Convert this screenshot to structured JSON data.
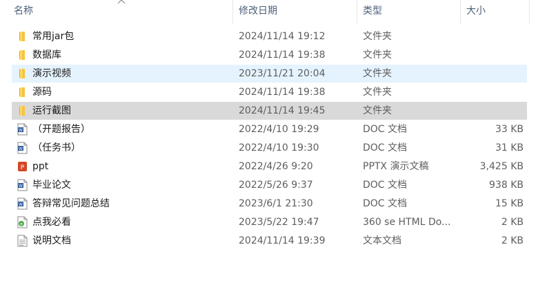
{
  "columns": {
    "name": "名称",
    "date": "修改日期",
    "type": "类型",
    "size": "大小"
  },
  "rows": [
    {
      "name": "常用jar包",
      "date": "2024/11/14 19:12",
      "type": "文件夹",
      "size": "",
      "icon": "folder-icon",
      "state": "normal"
    },
    {
      "name": "数据库",
      "date": "2024/11/14 19:38",
      "type": "文件夹",
      "size": "",
      "icon": "folder-icon",
      "state": "normal"
    },
    {
      "name": "演示视频",
      "date": "2023/11/21 20:04",
      "type": "文件夹",
      "size": "",
      "icon": "folder-icon",
      "state": "hover"
    },
    {
      "name": "源码",
      "date": "2024/11/14 19:38",
      "type": "文件夹",
      "size": "",
      "icon": "folder-icon",
      "state": "normal"
    },
    {
      "name": "运行截图",
      "date": "2024/11/14 19:45",
      "type": "文件夹",
      "size": "",
      "icon": "folder-icon",
      "state": "selected"
    },
    {
      "name": "（开题报告）",
      "date": "2022/4/10 19:29",
      "type": "DOC 文档",
      "size": "33 KB",
      "icon": "word-doc-icon",
      "state": "normal"
    },
    {
      "name": "（任务书）",
      "date": "2022/4/10 19:30",
      "type": "DOC 文档",
      "size": "31 KB",
      "icon": "word-doc-icon",
      "state": "normal"
    },
    {
      "name": "ppt",
      "date": "2022/4/26 9:20",
      "type": "PPTX 演示文稿",
      "size": "3,425 KB",
      "icon": "powerpoint-icon",
      "state": "normal"
    },
    {
      "name": "毕业论文",
      "date": "2022/5/26 9:37",
      "type": "DOC 文档",
      "size": "938 KB",
      "icon": "word-doc-icon",
      "state": "normal"
    },
    {
      "name": "答辩常见问题总结",
      "date": "2023/6/1 21:30",
      "type": "DOC 文档",
      "size": "15 KB",
      "icon": "word-doc-icon",
      "state": "normal"
    },
    {
      "name": "点我必看",
      "date": "2023/5/22 19:47",
      "type": "360 se HTML Do...",
      "size": "2 KB",
      "icon": "html-doc-icon",
      "state": "normal"
    },
    {
      "name": "说明文档",
      "date": "2024/11/14 19:39",
      "type": "文本文档",
      "size": "2 KB",
      "icon": "text-doc-icon",
      "state": "normal"
    }
  ],
  "colors": {
    "hover": "#e5f3ff",
    "selected": "#d9d9d9",
    "header_text": "#4c607a",
    "folder": "#f5c443"
  }
}
